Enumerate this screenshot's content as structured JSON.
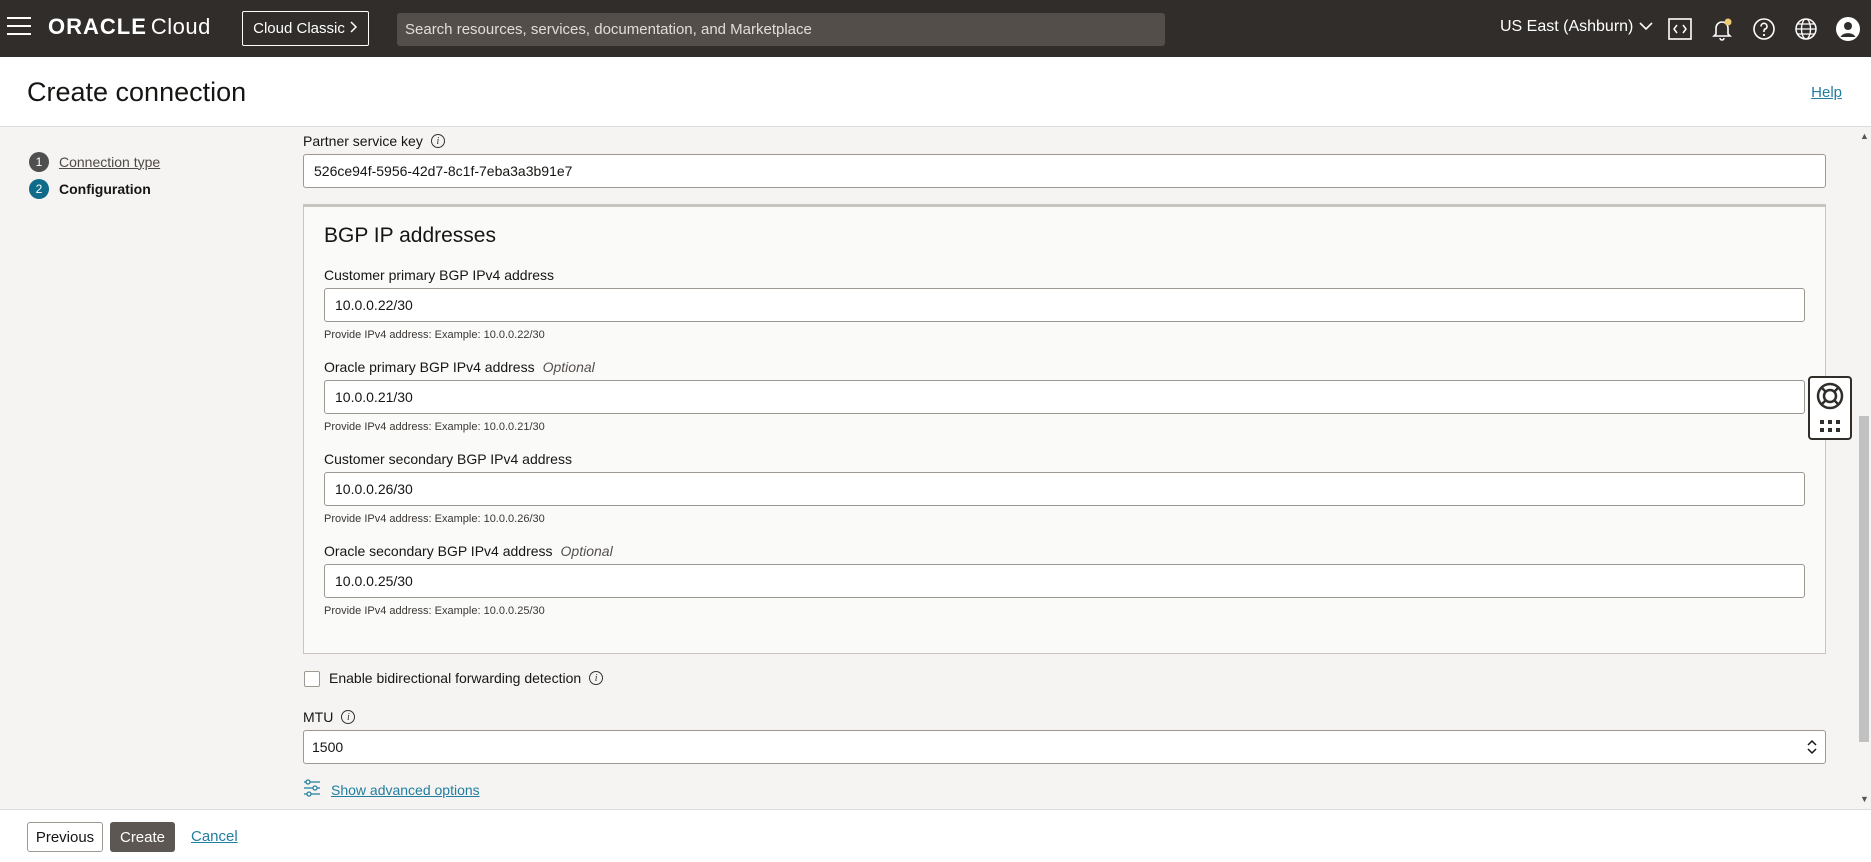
{
  "topbar": {
    "brand": "ORACLE",
    "brand_suffix": "Cloud",
    "classic_button": "Cloud Classic",
    "search_placeholder": "Search resources, services, documentation, and Marketplace",
    "region": "US East (Ashburn)",
    "icons": [
      "code-editor-icon",
      "bell-icon",
      "help-icon",
      "globe-icon",
      "user-icon"
    ]
  },
  "header": {
    "title": "Create connection",
    "help_link": "Help"
  },
  "steps": [
    {
      "num": "1",
      "label": "Connection type",
      "active": false
    },
    {
      "num": "2",
      "label": "Configuration",
      "active": true
    }
  ],
  "form": {
    "partner_key": {
      "label": "Partner service key",
      "value": "526ce94f-5956-42d7-8c1f-7eba3a3b91e7"
    },
    "bgp": {
      "title": "BGP IP addresses",
      "fields": [
        {
          "label": "Customer primary BGP IPv4 address",
          "optional": "",
          "value": "10.0.0.22/30",
          "hint": "Provide IPv4 address: Example: 10.0.0.22/30"
        },
        {
          "label": "Oracle primary BGP IPv4 address",
          "optional": "Optional",
          "value": "10.0.0.21/30",
          "hint": "Provide IPv4 address: Example: 10.0.0.21/30"
        },
        {
          "label": "Customer secondary BGP IPv4 address",
          "optional": "",
          "value": "10.0.0.26/30",
          "hint": "Provide IPv4 address: Example: 10.0.0.26/30"
        },
        {
          "label": "Oracle secondary BGP IPv4 address",
          "optional": "Optional",
          "value": "10.0.0.25/30",
          "hint": "Provide IPv4 address: Example: 10.0.0.25/30"
        }
      ]
    },
    "bfd": {
      "label": "Enable bidirectional forwarding detection",
      "checked": false
    },
    "mtu": {
      "label": "MTU",
      "value": "1500"
    },
    "advanced": "Show advanced options"
  },
  "footer": {
    "previous": "Previous",
    "create": "Create",
    "cancel": "Cancel"
  },
  "colors": {
    "topbar": "#312d2a",
    "link": "#227e9e",
    "active_step": "#0f6b8a",
    "primary_button": "#5c5753"
  }
}
